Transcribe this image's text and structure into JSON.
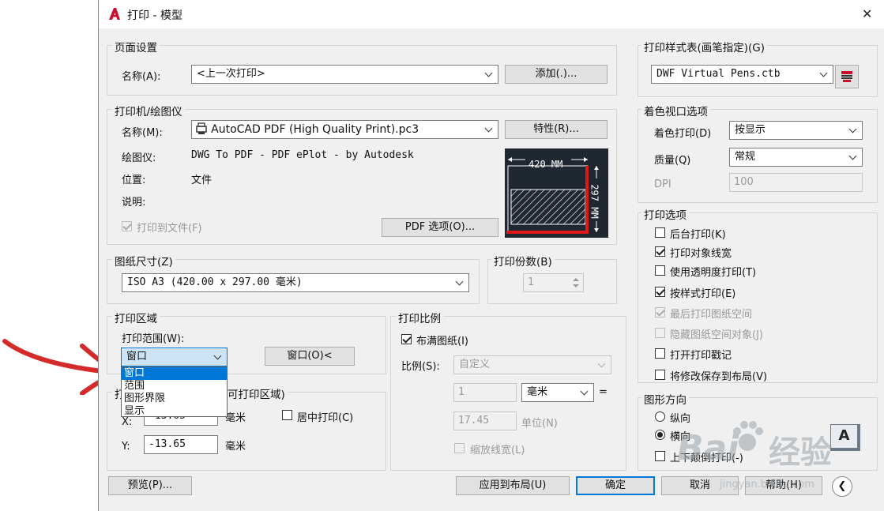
{
  "title": "打印 - 模型",
  "close_glyph": "✕",
  "page_setup": {
    "group": "页面设置",
    "name_label": "名称(A):",
    "name_value": "<上一次打印>",
    "add_button": "添加(.)..."
  },
  "printer": {
    "group": "打印机/绘图仪",
    "name_label": "名称(M):",
    "name_value": "AutoCAD PDF (High Quality Print).pc3",
    "properties_button": "特性(R)...",
    "plotter_label": "绘图仪:",
    "plotter_value": "DWG To PDF - PDF ePlot - by Autodesk",
    "location_label": "位置:",
    "location_value": "文件",
    "description_label": "说明:",
    "print_to_file": "打印到文件(F)",
    "pdf_options_button": "PDF 选项(O)...",
    "preview_width": "420 MM",
    "preview_height": "297 MM"
  },
  "paper_size": {
    "group": "图纸尺寸(Z)",
    "value": "ISO A3 (420.00 x 297.00 毫米)"
  },
  "copies": {
    "group": "打印份数(B)",
    "value": "1"
  },
  "plot_area": {
    "group": "打印区域",
    "range_label": "打印范围(W):",
    "range_value": "窗口",
    "window_button": "窗口(O)<",
    "dropdown_options": [
      "窗口",
      "范围",
      "图形界限",
      "显示"
    ]
  },
  "plot_offset": {
    "group_partial": "打",
    "group_rest": "可打印区域)",
    "x_label": "X:",
    "x_value": "-13.65",
    "x_unit": "毫米",
    "y_label": "Y:",
    "y_value": "-13.65",
    "y_unit": "毫米",
    "center": "居中打印(C)"
  },
  "plot_scale": {
    "group": "打印比例",
    "fit": "布满图纸(I)",
    "scale_label": "比例(S):",
    "scale_value": "自定义",
    "num_value": "1",
    "unit_value": "毫米",
    "equals": "=",
    "den_value": "17.45",
    "unit_label": "单位(N)",
    "scale_lineweights": "缩放线宽(L)"
  },
  "plot_style": {
    "group": "打印样式表(画笔指定)(G)",
    "value": "DWF Virtual Pens.ctb"
  },
  "shaded": {
    "group": "着色视口选项",
    "shade_label": "着色打印(D)",
    "shade_value": "按显示",
    "quality_label": "质量(Q)",
    "quality_value": "常规",
    "dpi_label": "DPI",
    "dpi_value": "100"
  },
  "plot_options": {
    "group": "打印选项",
    "items": [
      {
        "label": "后台打印(K)"
      },
      {
        "label": "打印对象线宽"
      },
      {
        "label": "使用透明度打印(T)"
      },
      {
        "label": "按样式打印(E)"
      },
      {
        "label": "最后打印图纸空间"
      },
      {
        "label": "隐藏图纸空间对象(J)"
      },
      {
        "label": "打开打印戳记"
      },
      {
        "label": "将修改保存到布局(V)"
      }
    ]
  },
  "orientation": {
    "group": "图形方向",
    "portrait": "纵向",
    "landscape": "横向",
    "upside_down": "上下颠倒打印(-)",
    "icon_letter": "A"
  },
  "footer": {
    "preview": "预览(P)...",
    "apply": "应用到布局(U)",
    "ok": "确定",
    "cancel": "取消",
    "help": "帮助(H)",
    "collapse_glyph": "❮"
  },
  "watermark": {
    "brand": "Bai",
    "brand_cn": "经验",
    "url": "jingyan.baidu.com"
  },
  "colors": {
    "accent": "#0078d7",
    "autocad_red": "#c8102e",
    "annotation_red": "#d42a2a",
    "preview_bg": "#1f2730"
  }
}
